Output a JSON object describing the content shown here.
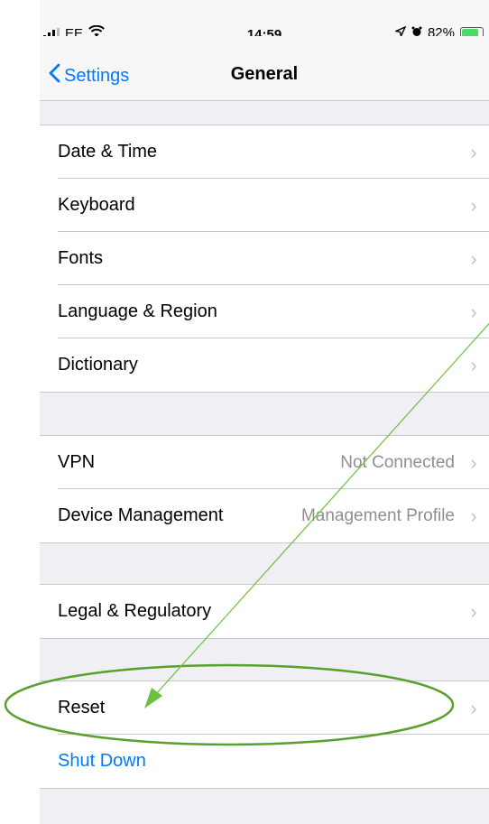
{
  "status_bar": {
    "carrier": "EE",
    "time": "14:59",
    "battery": "82%"
  },
  "nav": {
    "back_label": "Settings",
    "title": "General"
  },
  "groups": [
    {
      "items": [
        {
          "label": "Date & Time",
          "value": ""
        },
        {
          "label": "Keyboard",
          "value": ""
        },
        {
          "label": "Fonts",
          "value": ""
        },
        {
          "label": "Language & Region",
          "value": ""
        },
        {
          "label": "Dictionary",
          "value": ""
        }
      ]
    },
    {
      "items": [
        {
          "label": "VPN",
          "value": "Not Connected"
        },
        {
          "label": "Device Management",
          "value": "Management Profile"
        }
      ]
    },
    {
      "items": [
        {
          "label": "Legal & Regulatory",
          "value": ""
        }
      ]
    },
    {
      "items": [
        {
          "label": "Reset",
          "value": ""
        },
        {
          "label": "Shut Down",
          "value": ""
        }
      ]
    }
  ],
  "annotation": {
    "highlight_color": "#5aa02c",
    "arrow_color": "#6cbf3f"
  }
}
